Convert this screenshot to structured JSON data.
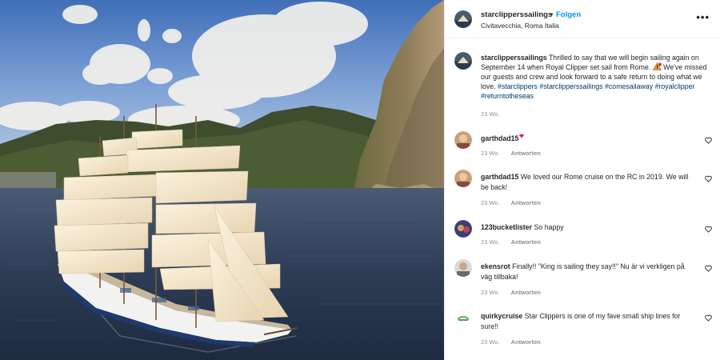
{
  "post": {
    "username": "starclipperssailings",
    "separator": "•",
    "follow_label": "Folgen",
    "location": "Civitavecchia, Roma Italia",
    "more_icon": "more-horizontal-icon",
    "more_label": "•••"
  },
  "caption": {
    "username": "starclipperssailings",
    "text_before_icon": "Thrilled to say that we will begin sailing again on September 14 when Royal Clipper set sail from Rome.",
    "text_after_icon": "We've missed our guests and crew and look forward to a safe return to doing what we love.",
    "hashtags": "#starclippers #starclipperssailings #comesailaway #royalclipper #returntotheseas",
    "time": "23 Wo."
  },
  "reply_label": "Antworten",
  "comments": [
    {
      "username": "garthdad15",
      "text": "",
      "time": "23 Wo.",
      "reply": "Antworten"
    },
    {
      "username": "garthdad15",
      "text": "We loved our Rome cruise on the RC in 2019. We will be back!",
      "time": "23 Wo.",
      "reply": "Antworten"
    },
    {
      "username": "123bucketlister",
      "text": "So happy",
      "time": "23 Wo.",
      "reply": "Antworten"
    },
    {
      "username": "ekensrot",
      "text": "Finally!! \"King is sailing they say!!\" Nu är vi verkligen på väg tillbaka!",
      "time": "23 Wo.",
      "reply": "Antworten"
    },
    {
      "username": "quirkycruise",
      "text": "Star Clippers is one of my fave small ship lines for sure!!",
      "time": "23 Wo.",
      "reply": "Antworten"
    }
  ],
  "colors": {
    "follow": "#0095f6",
    "hashtag": "#00376b",
    "muted": "#8e8e8e",
    "text": "#262626"
  }
}
